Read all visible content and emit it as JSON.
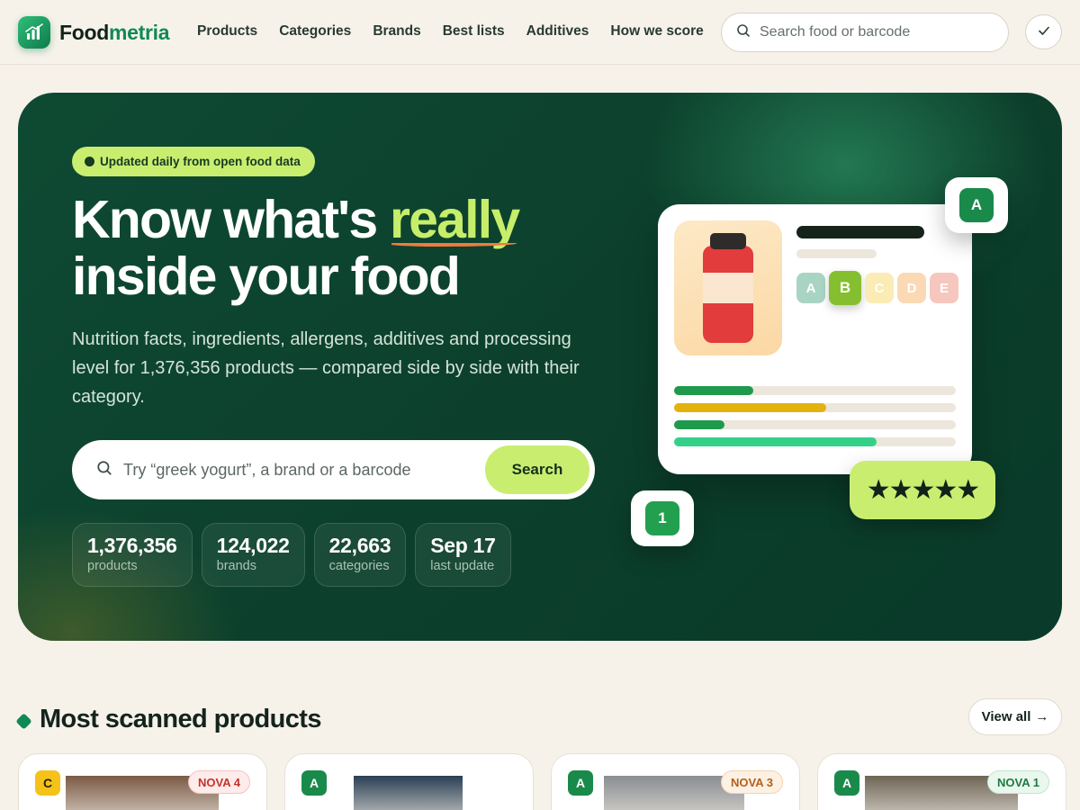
{
  "brand": {
    "name_prefix": "Food",
    "name_accent": "metria"
  },
  "nav": [
    "Products",
    "Categories",
    "Brands",
    "Best lists",
    "Additives",
    "How we score"
  ],
  "header_search": {
    "placeholder": "Search food or barcode"
  },
  "hero": {
    "pill": "Updated daily from open food data",
    "title_before": "Know what's ",
    "title_highlight": "really",
    "title_after": "inside your food",
    "lead": "Nutrition facts, ingredients, allergens, additives and processing level for 1,376,356 products — compared side by side with their category.",
    "search_placeholder": "Try “greek yogurt”, a brand or a barcode",
    "search_button": "Search",
    "stats": [
      {
        "value": "1,376,356",
        "label": "products"
      },
      {
        "value": "124,022",
        "label": "brands"
      },
      {
        "value": "22,663",
        "label": "categories"
      },
      {
        "value": "Sep 17",
        "label": "last update"
      }
    ]
  },
  "illustration": {
    "grades": [
      {
        "letter": "A",
        "color": "#a9d4c4"
      },
      {
        "letter": "B",
        "color": "#85bf2f"
      },
      {
        "letter": "C",
        "color": "#fbecb5"
      },
      {
        "letter": "D",
        "color": "#fad9b4"
      },
      {
        "letter": "E",
        "color": "#f6c7be"
      }
    ],
    "active_grade": "B",
    "nutrient_bars": [
      {
        "fraction": 0.28,
        "color": "#1f9a4d"
      },
      {
        "fraction": 0.54,
        "color": "#e3b20f"
      },
      {
        "fraction": 0.18,
        "color": "#1f9a4d"
      },
      {
        "fraction": 0.72,
        "color": "#34d08a"
      }
    ],
    "badge_score": "A",
    "badge_nova": "1",
    "stars": "★★★★★",
    "star_rating": 5
  },
  "section": {
    "title": "Most scanned products",
    "view_all": "View all",
    "view_all_arrow": "→"
  },
  "products": [
    {
      "score": "C",
      "score_bg": "#f5c21a",
      "score_fg": "#2a2100",
      "nova": "NOVA 4",
      "nova_bg": "#fdecea",
      "nova_fg": "#c8302a",
      "nova_border": "#f5c4bf",
      "photo_color": "#7a5a44"
    },
    {
      "score": "A",
      "score_bg": "#1a8a4b",
      "score_fg": "#ffffff",
      "nova": "",
      "nova_bg": "",
      "nova_fg": "",
      "nova_border": "",
      "photo_color": "#2a3f55"
    },
    {
      "score": "A",
      "score_bg": "#1a8a4b",
      "score_fg": "#ffffff",
      "nova": "NOVA 3",
      "nova_bg": "#fdf1e4",
      "nova_fg": "#b5601b",
      "nova_border": "#f4d3b0",
      "photo_color": "#8a8d92"
    },
    {
      "score": "A",
      "score_bg": "#1a8a4b",
      "score_fg": "#ffffff",
      "nova": "NOVA 1",
      "nova_bg": "#eaf7ee",
      "nova_fg": "#1d7a42",
      "nova_border": "#c3e7cf",
      "photo_color": "#6f6556"
    }
  ]
}
